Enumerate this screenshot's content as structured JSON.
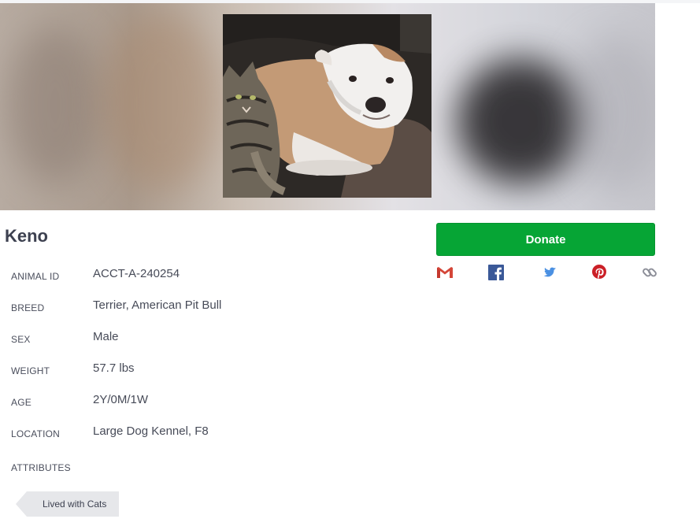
{
  "animal": {
    "name": "Keno",
    "details": [
      {
        "label": "ANIMAL ID",
        "value": "ACCT-A-240254"
      },
      {
        "label": "BREED",
        "value": "Terrier, American Pit Bull"
      },
      {
        "label": "SEX",
        "value": "Male"
      },
      {
        "label": "WEIGHT",
        "value": "57.7 lbs"
      },
      {
        "label": "AGE",
        "value": "2Y/0M/1W"
      },
      {
        "label": "LOCATION",
        "value": "Large Dog Kennel, F8"
      }
    ],
    "attributes_label": "ATTRIBUTES",
    "attributes": [
      "Lived with Cats"
    ]
  },
  "actions": {
    "donate_label": "Donate",
    "share_icons": [
      "gmail-icon",
      "facebook-icon",
      "twitter-icon",
      "pinterest-icon",
      "link-icon"
    ]
  },
  "colors": {
    "donate_green": "#06a535",
    "gmail_red": "#d44638",
    "facebook_blue": "#3b5998",
    "twitter_blue": "#4a90e2",
    "pinterest_red": "#cb2027",
    "link_gray": "#8d8f99",
    "tag_gray": "#e6e7ea"
  }
}
